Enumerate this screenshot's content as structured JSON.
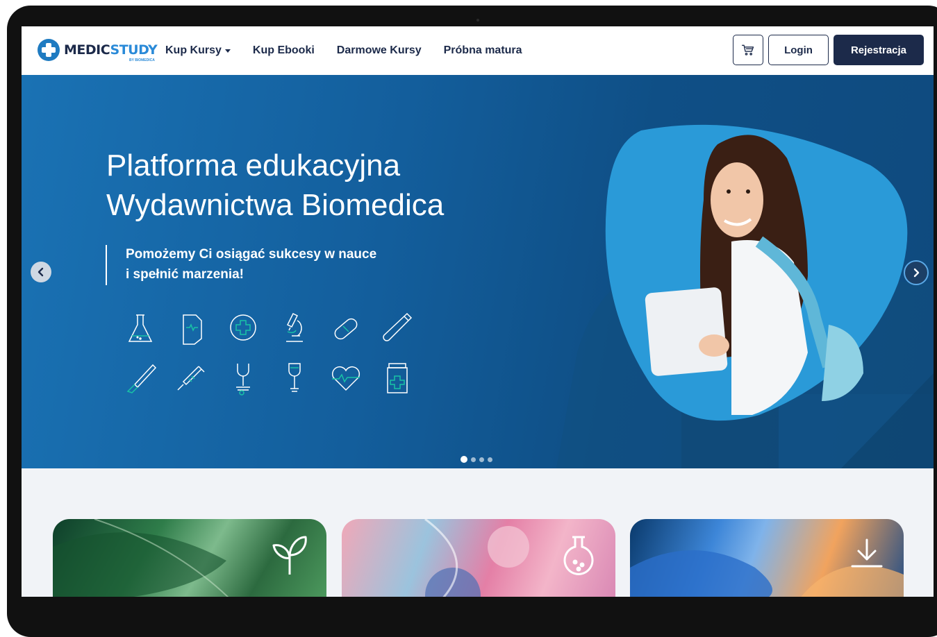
{
  "brand": {
    "name_part1": "MEDIC",
    "name_part2": "STUDY",
    "tagline": "BY BIOMEDICA"
  },
  "nav": {
    "items": [
      {
        "label": "Kup Kursy",
        "has_dropdown": true
      },
      {
        "label": "Kup Ebooki",
        "has_dropdown": false
      },
      {
        "label": "Darmowe Kursy",
        "has_dropdown": false
      },
      {
        "label": "Próbna matura",
        "has_dropdown": false
      }
    ],
    "cart_icon": "cart-icon",
    "login_label": "Login",
    "register_label": "Rejestracja"
  },
  "hero": {
    "title_line1": "Platforma edukacyjna",
    "title_line2": "Wydawnictwa Biomedica",
    "subtitle_line1": "Pomożemy Ci osiągać sukcesy w nauce",
    "subtitle_line2": "i spełnić marzenia!",
    "icons": [
      "flask-icon",
      "ekg-document-icon",
      "medical-cross-icon",
      "microscope-icon",
      "pill-icon",
      "test-tube-icon",
      "scalpel-icon",
      "syringe-icon",
      "stethoscope-icon",
      "iv-drip-icon",
      "heart-rate-icon",
      "medicine-jar-icon"
    ],
    "slides_count": 4,
    "active_slide": 1
  },
  "cards": [
    {
      "icon": "leaf-icon"
    },
    {
      "icon": "chemistry-flask-icon"
    },
    {
      "icon": "download-icon"
    }
  ],
  "colors": {
    "navy": "#1c2a4a",
    "brand_blue": "#2a8ad8",
    "hero_blue": "#135e9c",
    "accent_green": "#19c3a6"
  }
}
